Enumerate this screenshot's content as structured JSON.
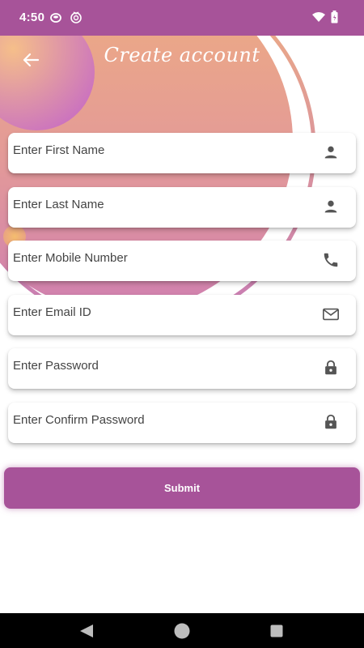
{
  "status_bar": {
    "time": "4:50",
    "icons": [
      "notification-app-icon",
      "notification-app-icon-2",
      "wifi-icon",
      "battery-icon"
    ]
  },
  "header": {
    "title": "Create account",
    "back_icon": "arrow-left-icon"
  },
  "form": {
    "fields": [
      {
        "placeholder": "Enter First Name",
        "value": "",
        "icon": "person-icon"
      },
      {
        "placeholder": "Enter Last Name",
        "value": "",
        "icon": "person-icon"
      },
      {
        "placeholder": "Enter Mobile Number",
        "value": "",
        "icon": "phone-icon"
      },
      {
        "placeholder": "Enter Email ID",
        "value": "",
        "icon": "mail-icon"
      },
      {
        "placeholder": "Enter Password",
        "value": "",
        "icon": "lock-icon"
      },
      {
        "placeholder": "Enter Confirm Password",
        "value": "",
        "icon": "lock-icon"
      }
    ],
    "submit_label": "Submit"
  },
  "nav_bar": {
    "icons": [
      "nav-back-icon",
      "nav-home-icon",
      "nav-recents-icon"
    ]
  },
  "colors": {
    "primary": "#a75399",
    "gradient_start": "#f0b27a",
    "gradient_end": "#c97bb3",
    "icon": "#555555"
  }
}
